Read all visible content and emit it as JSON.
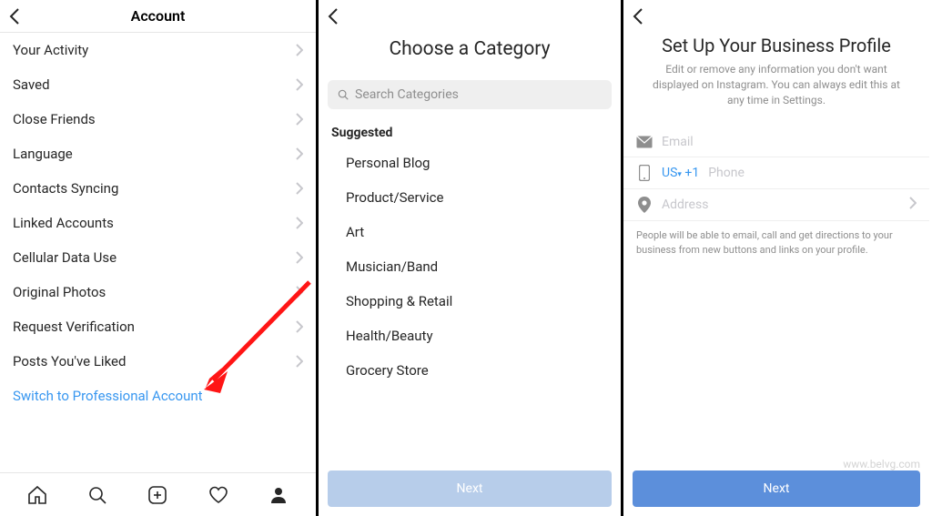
{
  "panel1": {
    "title": "Account",
    "items": [
      "Your Activity",
      "Saved",
      "Close Friends",
      "Language",
      "Contacts Syncing",
      "Linked Accounts",
      "Cellular Data Use",
      "Original Photos",
      "Request Verification",
      "Posts You've Liked"
    ],
    "link": "Switch to Professional Account"
  },
  "panel2": {
    "title": "Choose a Category",
    "search_placeholder": "Search Categories",
    "suggested_label": "Suggested",
    "items": [
      "Personal Blog",
      "Product/Service",
      "Art",
      "Musician/Band",
      "Shopping & Retail",
      "Health/Beauty",
      "Grocery Store"
    ],
    "next_label": "Next"
  },
  "panel3": {
    "title": "Set Up Your Business Profile",
    "subtitle": "Edit or remove any information you don't want displayed on Instagram. You can always edit this at any time in Settings.",
    "email_placeholder": "Email",
    "phone_country": "US",
    "phone_code": "+1",
    "phone_placeholder": "Phone",
    "address_placeholder": "Address",
    "note": "People will be able to email, call and get directions to your business from new buttons and links on your profile.",
    "next_label": "Next"
  },
  "watermark": "www.belvg.com"
}
